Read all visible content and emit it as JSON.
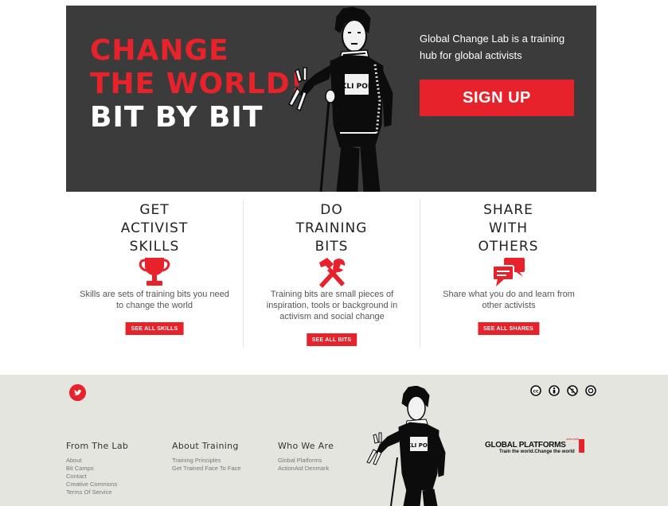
{
  "hero": {
    "line1": "CHANGE",
    "line2": "THE WORLD!",
    "line3": "BIT BY BIT",
    "tagline": "Global Change Lab is a training hub for global activists",
    "signup_label": "SIGN UP",
    "figure_shirt_text": "KLI POL",
    "colors": {
      "background": "#3b3b3b",
      "accent": "#e8222a"
    }
  },
  "features": [
    {
      "title_lines": [
        "GET",
        "ACTIVIST",
        "SKILLS"
      ],
      "icon": "trophy-icon",
      "description": "Skills are sets of training bits you need to change the world",
      "button_label": "SEE ALL SKILLS"
    },
    {
      "title_lines": [
        "DO",
        "TRAINING",
        "BITS"
      ],
      "icon": "hammer-wrench-icon",
      "description": "Training bits are small pieces of inspiration, tools or background in activism and social change",
      "button_label": "SEE ALL BITS"
    },
    {
      "title_lines": [
        "SHARE",
        "WITH",
        "OTHERS"
      ],
      "icon": "speech-bubbles-icon",
      "description": "Share what you do and learn from other activists",
      "button_label": "SEE ALL SHARES"
    }
  ],
  "footer": {
    "social_icon": "twitter-icon",
    "license_icons": [
      "cc-icon",
      "by-icon",
      "no-commercial-icon",
      "share-alike-icon"
    ],
    "columns": [
      {
        "heading": "From The Lab",
        "links": [
          "About",
          "Bit Camps",
          "Contact",
          "Creative Commons",
          "Terms Of Service"
        ]
      },
      {
        "heading": "About Training",
        "links": [
          "Training Principles",
          "Get Trained Face To Face"
        ]
      },
      {
        "heading": "Who We Are",
        "links": [
          "Global Platforms",
          "ActionAid Denmark"
        ]
      }
    ],
    "brand": {
      "name": "GLOBAL PLATFORMS",
      "tagline": "Train the world.Change the world",
      "small": "actionaid"
    },
    "colors": {
      "background": "#e5e5df"
    }
  }
}
